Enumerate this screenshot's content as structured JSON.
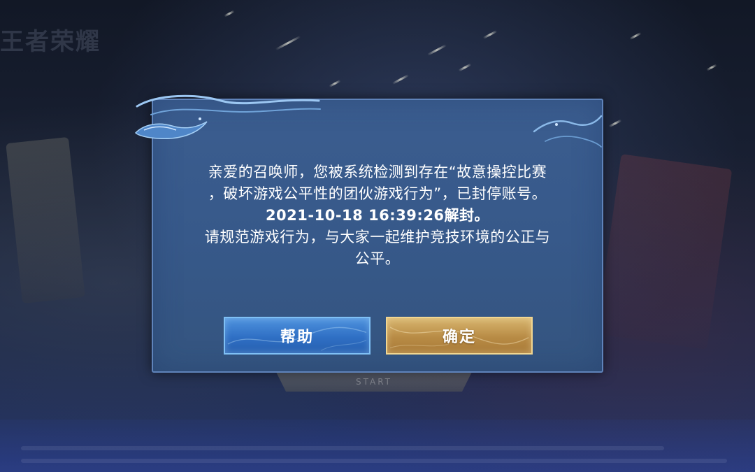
{
  "background": {
    "logo_text": "王者荣耀",
    "start_button_label": "START"
  },
  "dialog": {
    "message_lines": [
      "亲爱的召唤师，您被系统检测到存在“故意操控比赛",
      "，破坏游戏公平性的团伙游戏行为”，已封停账号。",
      "2021-10-18 16:39:26解封。",
      "请规范游戏行为，与大家一起维护竞技环境的公正与",
      "公平。"
    ],
    "help_label": "帮助",
    "confirm_label": "确定"
  },
  "colors": {
    "dialog_bg": "#3a5c8d",
    "dialog_border": "#5f83ba",
    "help_button": "#3f7fd0",
    "confirm_button": "#c49a55"
  }
}
